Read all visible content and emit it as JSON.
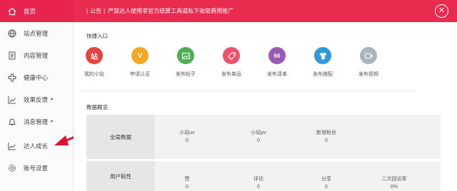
{
  "sidebar": {
    "items": [
      {
        "label": "首页",
        "icon": "home-icon",
        "active": true
      },
      {
        "label": "站点管理",
        "icon": "globe-icon"
      },
      {
        "label": "内容管理",
        "icon": "document-icon"
      },
      {
        "label": "健康中心",
        "icon": "plus-icon"
      },
      {
        "label": "效果反馈",
        "icon": "chart-icon",
        "dropdown": true
      },
      {
        "label": "消息管理",
        "icon": "bell-icon",
        "dropdown": true
      },
      {
        "label": "达人成长",
        "icon": "trend-icon"
      },
      {
        "label": "账号设置",
        "icon": "settings-icon"
      }
    ],
    "caret": "▾"
  },
  "notice": {
    "tag": "公告",
    "text": "严禁达人使用非官方结算工具或私下收取费用推广",
    "close": "✕"
  },
  "quick_entry": {
    "title": "快捷入口",
    "items": [
      {
        "label": "我的小站",
        "glyph": "站",
        "color": "#e8433a"
      },
      {
        "label": "申请认证",
        "glyph": "V",
        "color": "#f5a623"
      },
      {
        "label": "发布帖子",
        "glyph": "",
        "color": "#4cb050"
      },
      {
        "label": "发布单品",
        "glyph": "",
        "color": "#f0506e"
      },
      {
        "label": "发布清单",
        "glyph": "66",
        "color": "#9b59b6"
      },
      {
        "label": "发布搭配",
        "glyph": "",
        "color": "#2e9ad8"
      },
      {
        "label": "发布视频",
        "glyph": "",
        "color": "#a9b4bb"
      }
    ]
  },
  "data_overview": {
    "title": "数据概览",
    "rows": [
      {
        "label": "全局数据",
        "cells": [
          {
            "label": "小站uv",
            "value": "0"
          },
          {
            "label": "小站pv",
            "value": "0"
          },
          {
            "label": "新增粉丝",
            "value": "0"
          }
        ]
      },
      {
        "label": "用户粘性",
        "cells": [
          {
            "label": "赞",
            "value": "0"
          },
          {
            "label": "评论",
            "value": "0"
          },
          {
            "label": "分享",
            "value": "0"
          },
          {
            "label": "二次回访率",
            "value": "0%"
          }
        ]
      }
    ]
  },
  "colors": {
    "accent": "#e8234e",
    "arrow": "#e0102e"
  }
}
